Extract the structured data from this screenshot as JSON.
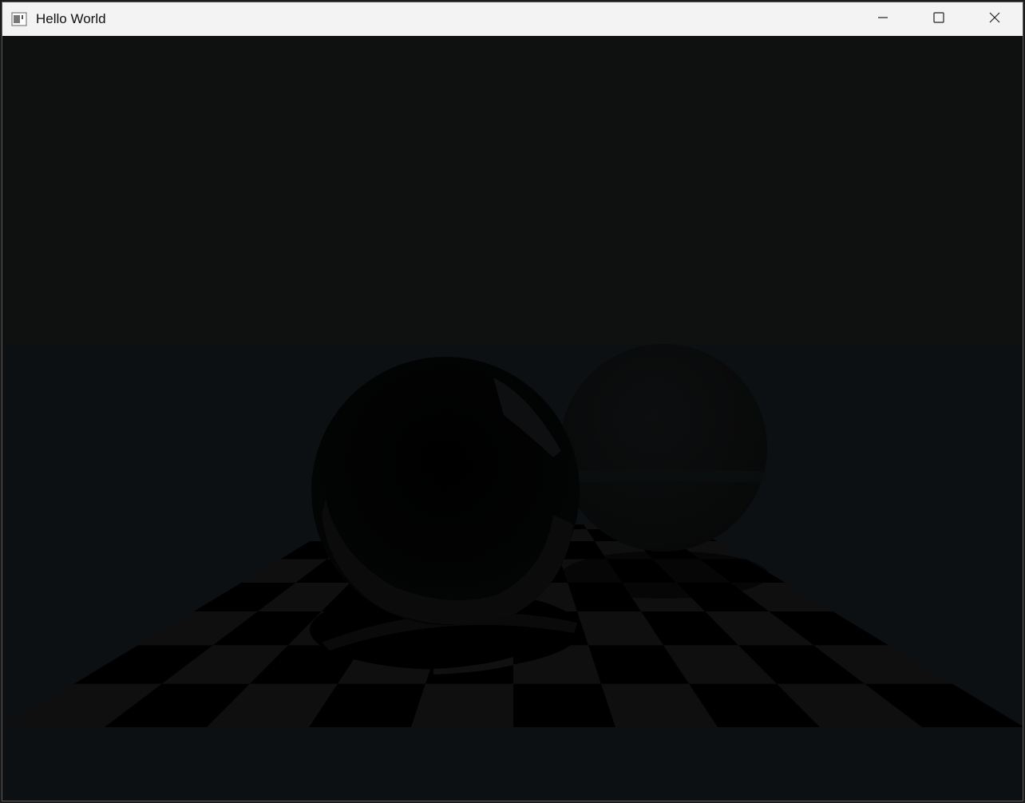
{
  "window": {
    "title": "Hello World",
    "app_icon": "console-app-icon"
  },
  "controls": {
    "minimize": "minimize-icon",
    "maximize": "maximize-icon",
    "close": "close-icon"
  },
  "scene": {
    "description_kind": "raytraced-render",
    "colors": {
      "sky": "#0f1010",
      "horizon": "#0c1012",
      "floor_dark": "#000000",
      "floor_light": "#0f0f0f",
      "sphere_left": "#000000",
      "sphere_right": "#0a0b0c"
    },
    "checkerboard": {
      "rows": 8,
      "cols": 10
    }
  }
}
